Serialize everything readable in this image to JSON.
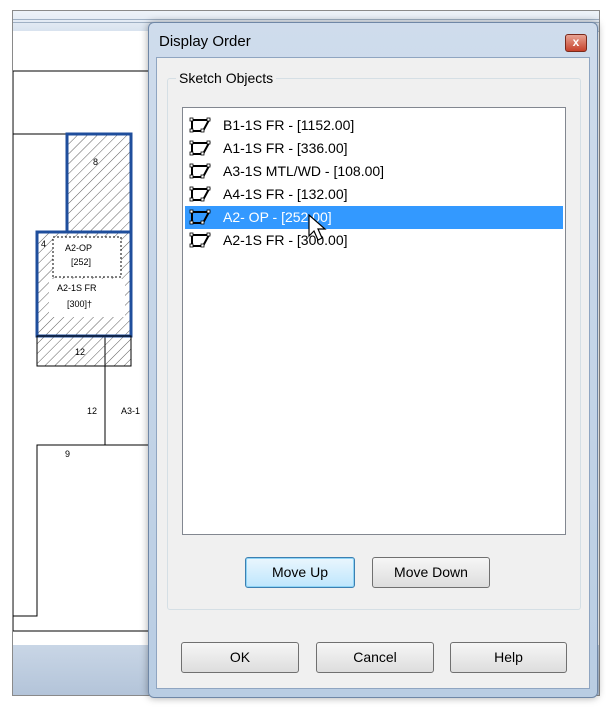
{
  "sketch": {
    "labels": [
      "8",
      "4",
      "A2-OP",
      "[252]",
      "A2-1S FR",
      "[300]†",
      "12",
      "12",
      "A3-1",
      "9"
    ]
  },
  "dialog": {
    "title": "Display Order",
    "close_label": "x",
    "group_label": "Sketch Objects",
    "items": [
      {
        "label": "B1-1S FR - [1152.00]",
        "icon": "sketch-polygon-icon"
      },
      {
        "label": "A1-1S FR - [336.00]",
        "icon": "sketch-polygon-icon"
      },
      {
        "label": "A3-1S MTL/WD - [108.00]",
        "icon": "sketch-polygon-icon"
      },
      {
        "label": "A4-1S FR - [132.00]",
        "icon": "sketch-polygon-icon"
      },
      {
        "label": "A2- OP  - [252.00]",
        "icon": "sketch-polygon-icon",
        "selected": true
      },
      {
        "label": "A2-1S FR - [300.00]",
        "icon": "sketch-polygon-icon"
      }
    ],
    "move_up_label": "Move Up",
    "move_down_label": "Move Down",
    "ok_label": "OK",
    "cancel_label": "Cancel",
    "help_label": "Help"
  },
  "colors": {
    "selection": "#3399ff",
    "sketch_highlight": "#1f4e9c"
  }
}
